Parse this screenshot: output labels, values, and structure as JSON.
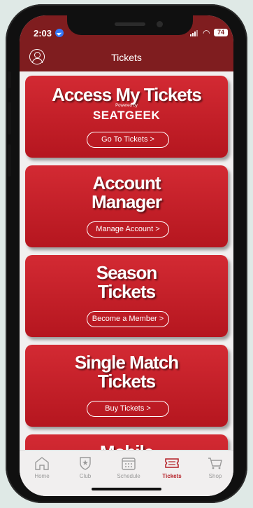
{
  "status_bar": {
    "time": "2:03",
    "battery": "74"
  },
  "header": {
    "title": "Tickets"
  },
  "cards": [
    {
      "title_lines": [
        "Access My Tickets"
      ],
      "powered_by": "Powered by",
      "partner": "SEATGEEK",
      "button": "Go To Tickets >"
    },
    {
      "title_lines": [
        "Account",
        "Manager"
      ],
      "button": "Manage Account >"
    },
    {
      "title_lines": [
        "Season",
        "Tickets"
      ],
      "button": "Become a Member >"
    },
    {
      "title_lines": [
        "Single Match",
        "Tickets"
      ],
      "button": "Buy Tickets >"
    },
    {
      "title_lines": [
        "Mobile"
      ]
    }
  ],
  "tabs": [
    {
      "label": "Home",
      "icon": "home-icon"
    },
    {
      "label": "Club",
      "icon": "club-crest-icon"
    },
    {
      "label": "Schedule",
      "icon": "calendar-icon"
    },
    {
      "label": "Tickets",
      "icon": "ticket-icon",
      "active": true
    },
    {
      "label": "Shop",
      "icon": "cart-icon"
    }
  ],
  "colors": {
    "header": "#7f1d1f",
    "card": "#c51f28",
    "active_tab": "#b41f26"
  }
}
